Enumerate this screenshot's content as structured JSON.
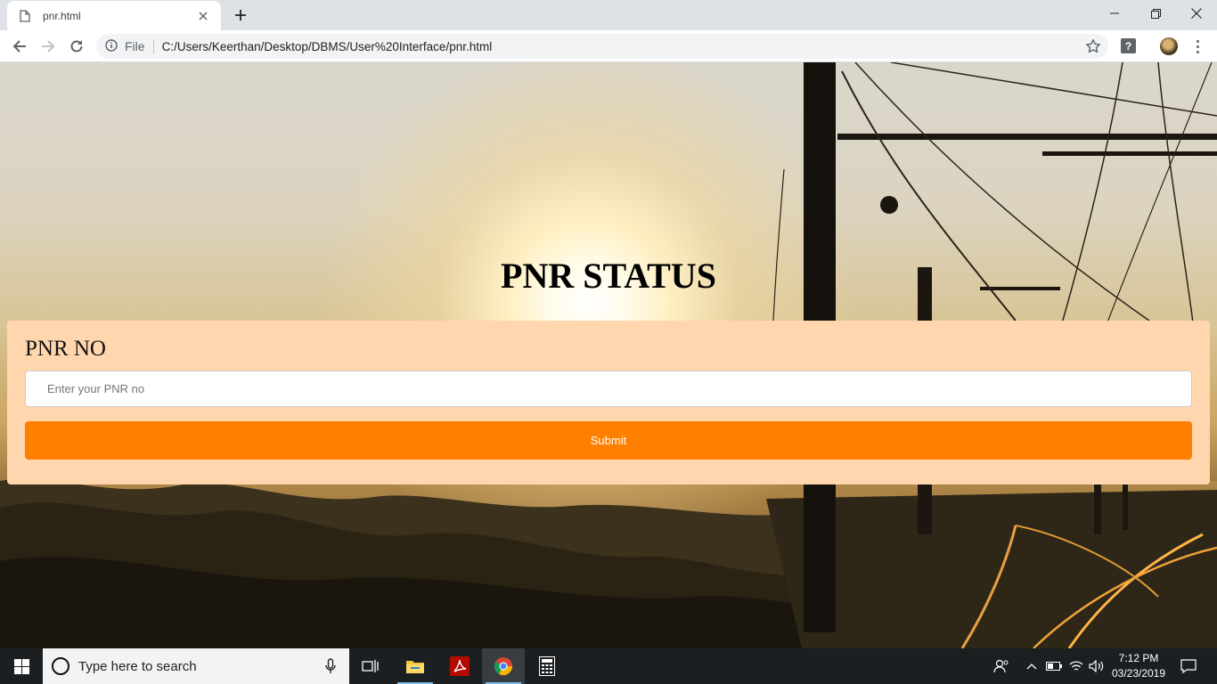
{
  "browser": {
    "tab_title": "pnr.html",
    "scheme_label": "File",
    "url": "C:/Users/Keerthan/Desktop/DBMS/User%20Interface/pnr.html",
    "extension_label": "?"
  },
  "page": {
    "title": "PNR STATUS",
    "form": {
      "label": "PNR NO",
      "input_placeholder": "Enter your PNR no",
      "input_value": "",
      "submit_label": "Submit"
    }
  },
  "taskbar": {
    "search_placeholder": "Type here to search",
    "time": "7:12 PM",
    "date": "03/23/2019"
  },
  "colors": {
    "card_background": "#ffd6ad",
    "submit_button": "#ff8000",
    "taskbar": "#1c1f22"
  }
}
